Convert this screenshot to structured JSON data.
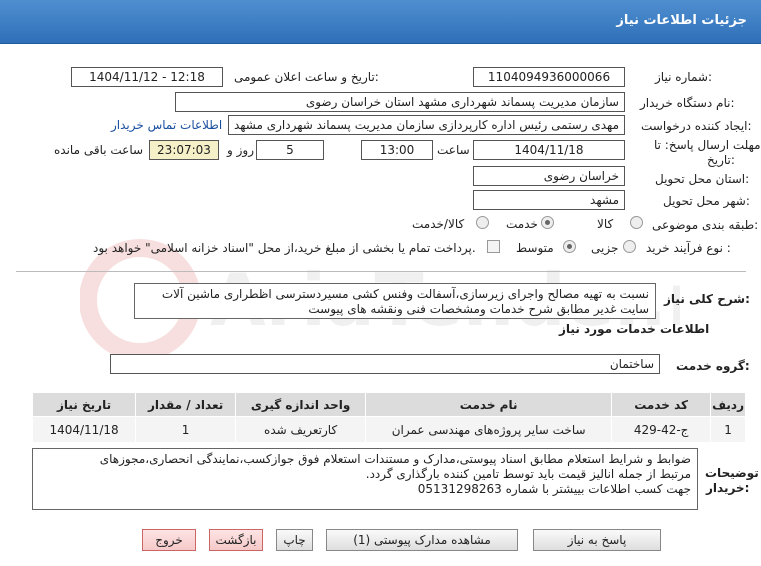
{
  "header": {
    "title": "جزئیات اطلاعات نیاز"
  },
  "fields": {
    "need_number_label": "شماره نیاز:",
    "need_number": "1104094936000066",
    "announce_label": "تاریخ و ساعت اعلان عمومی:",
    "announce_value": "1404/11/12 - 12:18",
    "buyer_label": "نام دستگاه خریدار:",
    "buyer_value": "سازمان مدیریت پسماند شهرداری مشهد استان خراسان رضوی",
    "creator_label": "ایجاد کننده درخواست:",
    "creator_value": "مهدی رستمی رئیس اداره کارپردازی سازمان مدیریت پسماند شهرداری مشهد ا",
    "contact_link": "اطلاعات تماس خریدار",
    "deadline_label_1": "مهلت ارسال پاسخ: تا",
    "deadline_label_2": "تاریخ:",
    "deadline_date": "1404/11/18",
    "time_label": "ساعت",
    "deadline_time": "13:00",
    "days_value": "5",
    "days_label": "روز و",
    "remaining_time": "23:07:03",
    "remaining_label": "ساعت باقی مانده",
    "province_label": "استان محل تحویل:",
    "province_value": "خراسان رضوی",
    "city_label": "شهر محل تحویل:",
    "city_value": "مشهد",
    "category_label": "طبقه بندی موضوعی:",
    "category_options": [
      "کالا",
      "خدمت",
      "کالا/خدمت"
    ],
    "category_selected": "خدمت",
    "process_label": "نوع فرآیند خرید :",
    "process_options": [
      "جزیی",
      "متوسط"
    ],
    "process_selected": "متوسط",
    "payment_note": "پرداخت تمام یا بخشی از مبلغ خرید،از محل \"اسناد خزانه اسلامی\" خواهد بود."
  },
  "summary": {
    "label": "شرح کلی نیاز:",
    "text": "نسبت به تهیه مصالح واجرای زیرسازی،آسفالت وفنس کشی مسیردسترسی اظطراری ماشین آلات سایت غدیر مطابق شرح خدمات ومشخصات فنی ونقشه های پیوست"
  },
  "services": {
    "section_title": "اطلاعات خدمات مورد نیاز",
    "group_label": "گروه خدمت:",
    "group_value": "ساختمان",
    "columns": [
      "ردیف",
      "کد خدمت",
      "نام خدمت",
      "واحد اندازه گیری",
      "تعداد / مقدار",
      "تاریخ نیاز"
    ],
    "rows": [
      {
        "row": "1",
        "code": "ج-42-429",
        "name": "ساخت سایر پروژه‌های مهندسی عمران",
        "unit": "کارتعریف شده",
        "qty": "1",
        "date": "1404/11/18"
      }
    ]
  },
  "notes": {
    "label_1": "توضیحات",
    "label_2": "خریدار:",
    "line1": "ضوابط و شرایط استعلام مطابق اسناد پیوستی،مدارک و مستندات استعلام فوق جوازکسب،نمایندگی انحصاری،مجوزهای",
    "line2": "مرتبط از جمله انالیز قیمت باید توسط تامین کننده بارگذاری گردد.",
    "line3": "جهت کسب اطلاعات بییشتر با شماره 05131298263"
  },
  "buttons": {
    "reply": "پاسخ به نیاز",
    "attachments": "مشاهده مدارک پیوستی (1)",
    "print": "چاپ",
    "back": "بازگشت",
    "exit": "خروج"
  },
  "watermark": {
    "text": "AriaTender.net"
  }
}
